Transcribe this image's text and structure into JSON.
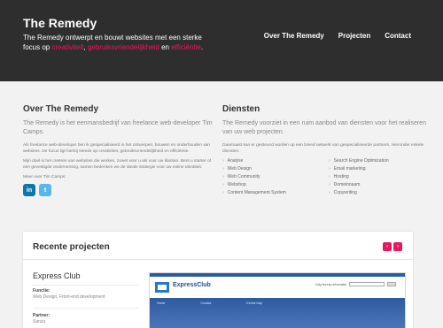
{
  "header": {
    "brand": "The Remedy",
    "tagline_parts": {
      "start": "The Remedy ontwerpt en bouwt websites met een sterke focus op ",
      "h1": "creativiteit",
      "sep1": ", ",
      "h2": "gebruiksvriendelijkheid",
      "sep2": " en ",
      "h3": "efficiëntie",
      "end": "."
    },
    "nav": [
      "Over The Remedy",
      "Projecten",
      "Contact"
    ]
  },
  "about": {
    "title": "Over The Remedy",
    "lead": "The Remedy is het eenmansbedrijf van freelance web-developer Tim Camps.",
    "p1": "Als freelance web-developer ben ik gespecialiseerd in het ontwerpen, bouwen en onderhouden van websites. De focus ligt hierbij steeds op creativiteit, gebruiksvriendelijkheid en efficiëntie.",
    "p2": "Mijn doel is het creëren van websites die werken, zowel voor u als voor uw klanten. Bent u starter of een gevestigde onderneming, samen bedenken we de ideale strategie voor uw online identiteit.",
    "p3": "Meer over Tim Camps:",
    "social": [
      "in",
      "t"
    ]
  },
  "services": {
    "title": "Diensten",
    "lead": "The Remedy voorziet in een ruim aanbod van diensten voor het realiseren van uw web projecten.",
    "p1": "Daarnaast kan er gesteund worden op een breed netwerk van gespecialiseerde partners. Hieronder enkele diensten:",
    "items": [
      "Analyse",
      "Search Engine Optimization",
      "Web Design",
      "Email marketing",
      "Web Community",
      "Hosting",
      "Webshop",
      "Domeinnaam",
      "Content Management System",
      "Copywriting"
    ]
  },
  "projects": {
    "title": "Recente projecten",
    "prev": "‹",
    "next": "›",
    "project_title": "Express Club",
    "function_label": "Functie:",
    "function_value": "Web Design, Front-end development",
    "partner_label": "Partner:",
    "partner_value": "Sanza",
    "preview": {
      "title": "ExpressClub",
      "search_label": "Volg bureau-informatie",
      "tabs": [
        "Home",
        "Contact",
        "Eerste hulp"
      ]
    }
  },
  "colors": {
    "accent": "#e5195f",
    "header_bg": "#2e2e2e",
    "page_bg": "#f2f2f2"
  }
}
